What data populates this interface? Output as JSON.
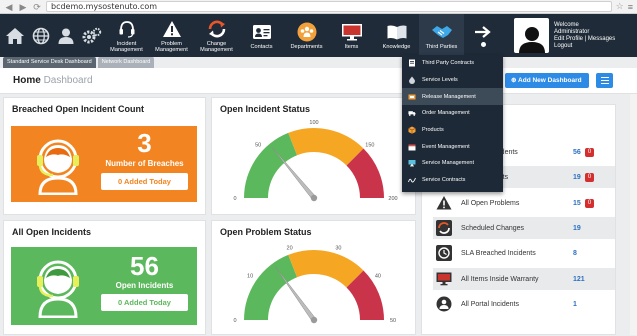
{
  "browser": {
    "url": "bcdemo.mysostenuto.com"
  },
  "quick_links": [
    "home-icon",
    "globe-icon",
    "user-icon",
    "settings-icon"
  ],
  "nav": [
    {
      "label": "Incident Management",
      "icon": "headset-icon"
    },
    {
      "label": "Problem Management",
      "icon": "warning-icon"
    },
    {
      "label": "Change Management",
      "icon": "change-icon"
    },
    {
      "label": "Contacts",
      "icon": "contacts-icon"
    },
    {
      "label": "Departments",
      "icon": "departments-icon"
    },
    {
      "label": "Items",
      "icon": "monitor-icon"
    },
    {
      "label": "Knowledge",
      "icon": "book-icon"
    },
    {
      "label": "Third Parties",
      "icon": "handshake-icon"
    }
  ],
  "user": {
    "welcome": "Welcome",
    "name": "Administrator",
    "edit_profile": "Edit Profile",
    "separator": "|",
    "messages": "Messages",
    "logout": "Logout"
  },
  "tabs": [
    "Standard Service Desk Dashboard",
    "Network Dashboard"
  ],
  "page": {
    "title": "Home",
    "subtitle": "Dashboard",
    "add_button": "Add New Dashboard"
  },
  "dropdown": [
    {
      "label": "Third Party Contracts",
      "icon": "contract-icon"
    },
    {
      "label": "Service Levels",
      "icon": "drop-icon"
    },
    {
      "label": "Release Management",
      "icon": "release-icon"
    },
    {
      "label": "Order Management",
      "icon": "truck-icon"
    },
    {
      "label": "Products",
      "icon": "box-icon"
    },
    {
      "label": "Event Management",
      "icon": "event-icon"
    },
    {
      "label": "Service Management",
      "icon": "service-icon"
    },
    {
      "label": "Service Contracts",
      "icon": "signature-icon"
    }
  ],
  "breached": {
    "title": "Breached Open Incident Count",
    "value": "3",
    "label": "Number of Breaches",
    "added": "0 Added Today",
    "color": "#f28521"
  },
  "all_open": {
    "title": "All Open Incidents",
    "value": "56",
    "label": "Open Incidents",
    "added": "0 Added Today",
    "color": "#5cb85c"
  },
  "gauge1": {
    "title": "Open Incident Status",
    "ticks": [
      "0",
      "50",
      "100",
      "150",
      "200"
    ],
    "min": 0,
    "max": 200,
    "needle_value": 56
  },
  "gauge2": {
    "title": "Open Problem Status",
    "ticks": [
      "0",
      "10",
      "20",
      "30",
      "40",
      "50"
    ],
    "min": 0,
    "max": 50,
    "needle_value": 15
  },
  "right_list": [
    {
      "label": "All Open Incidents",
      "count": "56",
      "badge": "0",
      "icon": "headset-icon",
      "shade": false
    },
    {
      "label": "Open Incidents",
      "count": "19",
      "badge": "0",
      "icon": "headset-icon",
      "shade": true
    },
    {
      "label": "All Open Problems",
      "count": "15",
      "badge": "0",
      "icon": "warning-icon",
      "shade": false
    },
    {
      "label": "Scheduled Changes",
      "count": "19",
      "badge": "",
      "icon": "change-icon",
      "shade": true
    },
    {
      "label": "SLA Breached Incidents",
      "count": "8",
      "badge": "",
      "icon": "sla-icon",
      "shade": false
    },
    {
      "label": "All Items Inside Warranty",
      "count": "121",
      "badge": "",
      "icon": "monitor-icon",
      "shade": true
    },
    {
      "label": "All Portal Incidents",
      "count": "1",
      "badge": "",
      "icon": "portal-icon",
      "shade": false
    }
  ]
}
